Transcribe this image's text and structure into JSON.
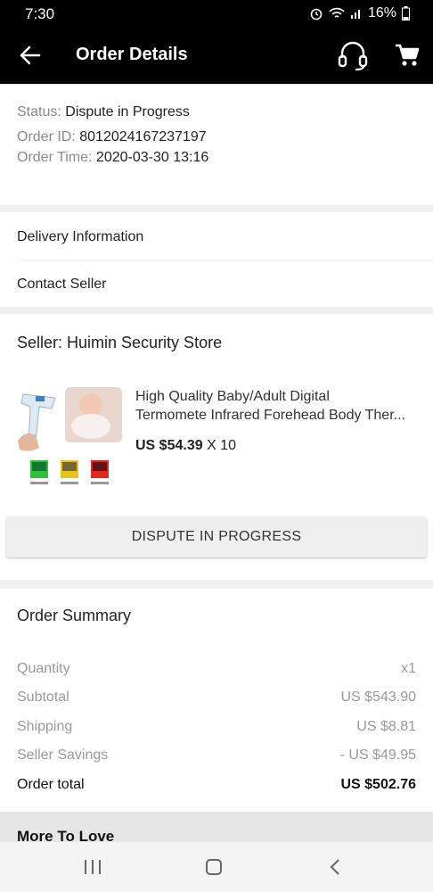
{
  "status_bar": {
    "time": "7:30",
    "battery": "16%"
  },
  "app_bar": {
    "title": "Order Details"
  },
  "order": {
    "status_label": "Status:",
    "status_value": "Dispute in Progress",
    "id_label": "Order ID:",
    "id_value": "8012024167237197",
    "time_label": "Order Time:",
    "time_value": "2020-03-30 13:16"
  },
  "links": {
    "delivery": "Delivery Information",
    "contact": "Contact Seller"
  },
  "product": {
    "seller": "Seller: Huimin Security Store",
    "name_line1": "High Quality Baby/Adult Digital",
    "name_line2": "Termomete Infrared Forehead Body Ther...",
    "price": "US $54.39",
    "qty": "X 10",
    "button": "DISPUTE IN PROGRESS"
  },
  "summary": {
    "title": "Order Summary",
    "rows": [
      {
        "label": "Quantity",
        "value": "x1"
      },
      {
        "label": "Subtotal",
        "value": "US $543.90"
      },
      {
        "label": "Shipping",
        "value": "US $8.81"
      },
      {
        "label": "Seller Savings",
        "value": "- US $49.95"
      },
      {
        "label": "Order total",
        "value": "US $502.76"
      }
    ]
  },
  "more_to_love": "More To Love",
  "colors": {
    "appbar": "#000000",
    "text_muted": "#8a8a8a"
  },
  "icons": [
    "back-arrow-icon",
    "headset-icon",
    "cart-icon",
    "alarm-icon",
    "wifi-icon",
    "signal-icon",
    "battery-icon"
  ]
}
